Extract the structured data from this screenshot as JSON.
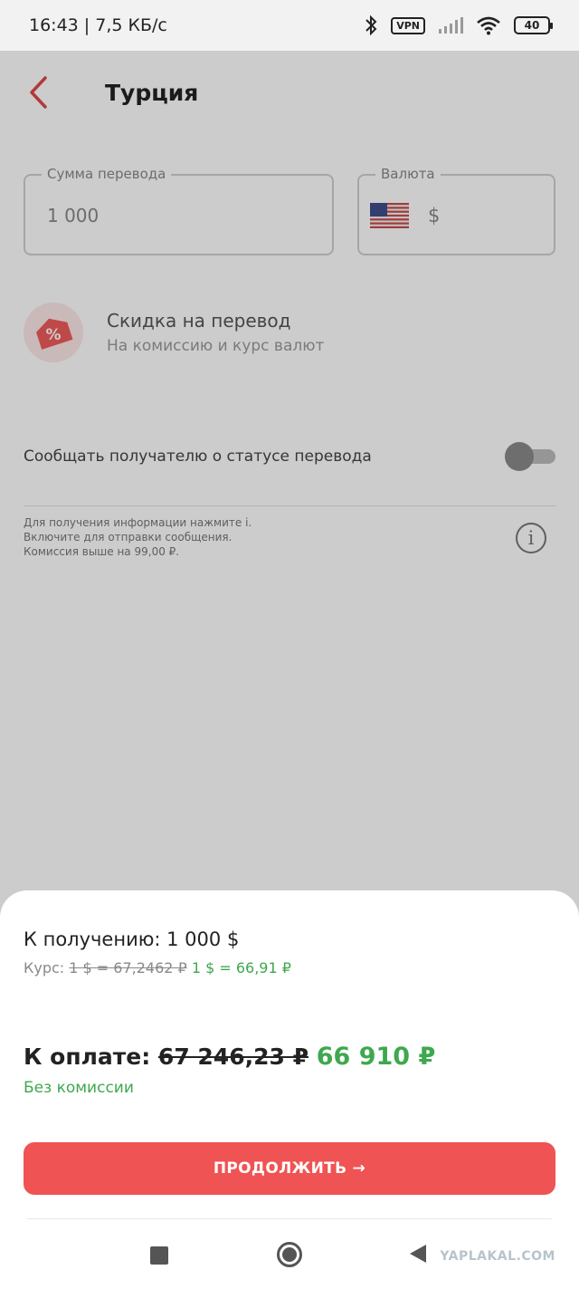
{
  "status_bar": {
    "time": "16:43 | 7,5 КБ/с",
    "vpn": "VPN",
    "battery": "40",
    "icons": [
      "bluetooth-icon",
      "vpn-icon",
      "signal-icon",
      "wifi-icon",
      "battery-icon"
    ]
  },
  "header": {
    "title": "Турция",
    "back_icon": "chevron-left-icon",
    "accent_color": "#e04848"
  },
  "form": {
    "amount_label": "Сумма перевода",
    "amount_value": "1 000",
    "currency_label": "Валюта",
    "currency_symbol": "$",
    "currency_flag": "us-flag-icon"
  },
  "discount": {
    "title": "Скидка на перевод",
    "subtitle": "На комиссию и курс валют",
    "icon": "percent-tag-icon"
  },
  "notify": {
    "label": "Сообщать получателю о статусе перевода",
    "enabled": false
  },
  "info": {
    "line1": "Для получения информации нажмите i.",
    "line2": "Включите для отправки сообщения.",
    "line3": "Комиссия выше на 99,00 ₽.",
    "icon_glyph": "i"
  },
  "sheet": {
    "receive": "К получению: 1 000 $",
    "rate_label": "Курс: ",
    "rate_old": "1 $ = 67,2462 ₽",
    "rate_new": "1 $ = 66,91 ₽",
    "pay_label": "К оплате: ",
    "pay_old": "67 246,23 ₽",
    "pay_new": "66 910 ₽",
    "no_fee": "Без комиссии",
    "continue_label": "ПРОДОЛЖИТЬ →",
    "button_color": "#f05353",
    "green_color": "#3ea84e"
  },
  "watermark": "YAPLAKAL.COM"
}
